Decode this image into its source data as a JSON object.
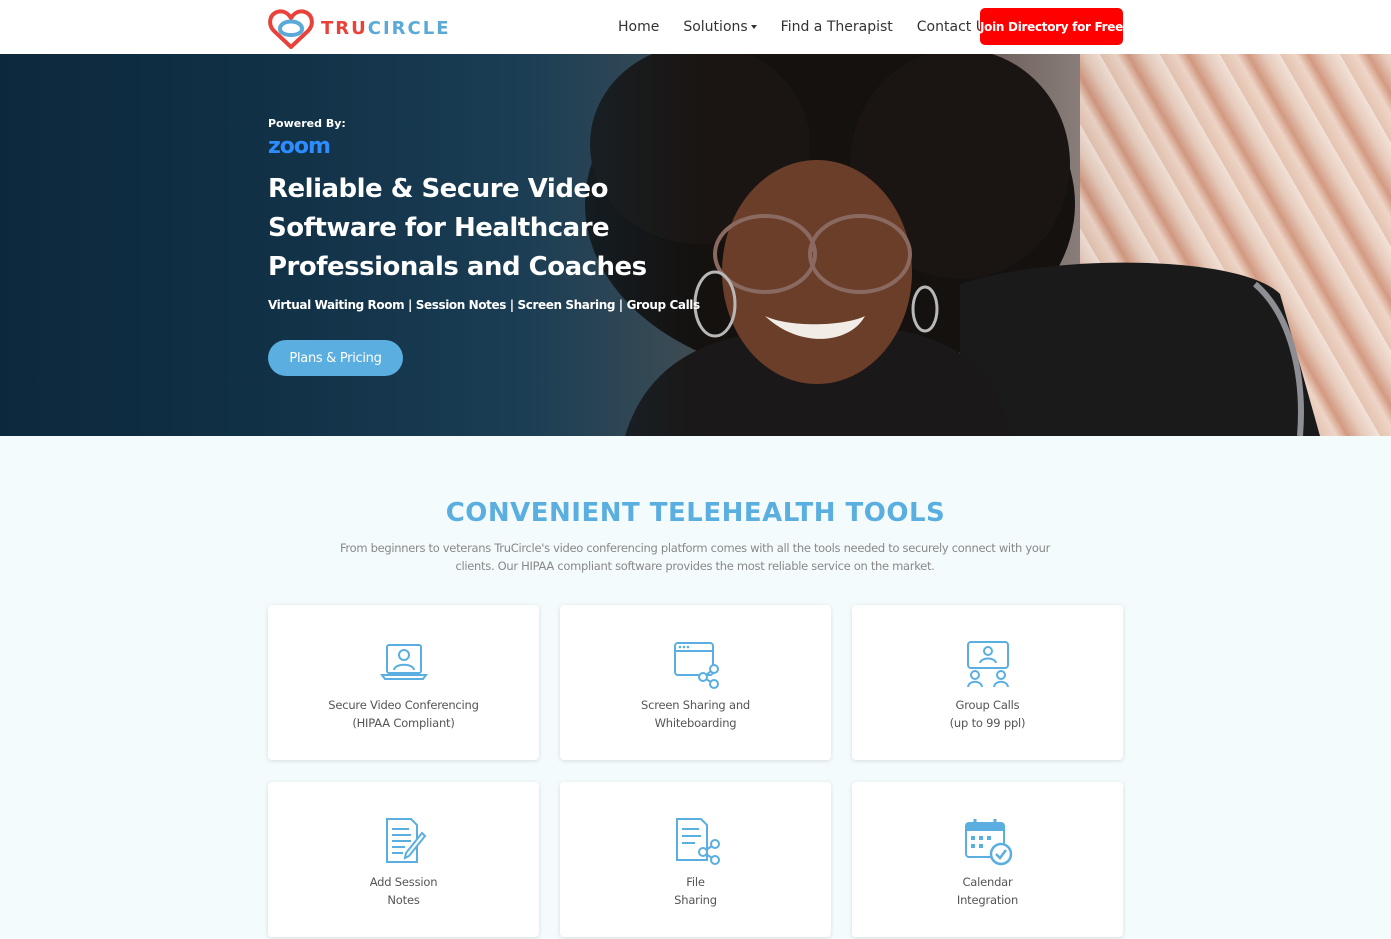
{
  "colors": {
    "accent": "#5aaee0",
    "brand_red": "#e8423a",
    "cta_red": "#ff0000",
    "zoom_blue": "#2d8cff"
  },
  "brand": {
    "part1": "TRU",
    "part2": "CIRCLE",
    "logo_icon": "heart-circle-icon"
  },
  "nav": {
    "home": "Home",
    "solutions": "Solutions",
    "find_therapist": "Find a Therapist",
    "contact": "Contact Us",
    "join": "Join Directory for Free"
  },
  "hero": {
    "powered_by": "Powered By:",
    "zoom": "zoom",
    "title": "Reliable & Secure Video Software for Healthcare Professionals and Coaches",
    "features": "Virtual Waiting Room | Session Notes | Screen Sharing | Group Calls",
    "cta": "Plans & Pricing"
  },
  "tools": {
    "title": "CONVENIENT TELEHEALTH TOOLS",
    "description": "From beginners to veterans TruCircle's video conferencing platform comes with all the tools needed to securely connect with your clients. Our HIPAA compliant software provides the most reliable service on the market.",
    "cards": [
      {
        "line1": "Secure Video Conferencing",
        "line2": "(HIPAA Compliant)",
        "icon": "laptop-user-icon"
      },
      {
        "line1": "Screen Sharing and",
        "line2": "Whiteboarding",
        "icon": "browser-share-icon"
      },
      {
        "line1": "Group Calls",
        "line2": "(up to 99 ppl)",
        "icon": "group-call-icon"
      },
      {
        "line1": "Add Session",
        "line2": "Notes",
        "icon": "notes-pencil-icon"
      },
      {
        "line1": "File",
        "line2": "Sharing",
        "icon": "file-share-icon"
      },
      {
        "line1": "Calendar",
        "line2": "Integration",
        "icon": "calendar-check-icon"
      }
    ]
  }
}
